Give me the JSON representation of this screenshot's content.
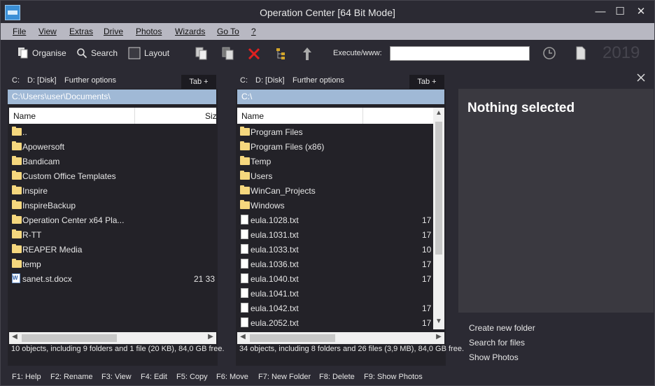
{
  "window": {
    "title": "Operation Center [64 Bit Mode]"
  },
  "window_controls": {
    "minimize": "—",
    "maximize": "☐",
    "close": "✕"
  },
  "menu": [
    "File",
    "View",
    "Extras",
    "Drive",
    "Photos",
    "Wizards",
    "Go To",
    "?"
  ],
  "toolbar": {
    "organise": "Organise",
    "search": "Search",
    "layout": "Layout",
    "execute_label": "Execute/www:",
    "execute_value": "",
    "year": "2019"
  },
  "left_panel": {
    "drives": [
      "C:",
      "D: [Disk]",
      "Further options"
    ],
    "tab_button": "Tab +",
    "path": "C:\\Users\\user\\Documents\\",
    "columns": [
      "Name",
      "Siz"
    ],
    "items": [
      {
        "name": "..",
        "size": "",
        "type": "folder"
      },
      {
        "name": "Apowersoft",
        "size": "",
        "type": "folder"
      },
      {
        "name": "Bandicam",
        "size": "",
        "type": "folder"
      },
      {
        "name": "Custom Office Templates",
        "size": "",
        "type": "folder"
      },
      {
        "name": "Inspire",
        "size": "",
        "type": "folder"
      },
      {
        "name": "InspireBackup",
        "size": "",
        "type": "folder"
      },
      {
        "name": "Operation Center x64 Pla...",
        "size": "",
        "type": "folder"
      },
      {
        "name": "R-TT",
        "size": "",
        "type": "folder"
      },
      {
        "name": "REAPER Media",
        "size": "",
        "type": "folder"
      },
      {
        "name": "temp",
        "size": "",
        "type": "folder"
      },
      {
        "name": "sanet.st.docx",
        "size": "21 33",
        "type": "docx"
      }
    ],
    "status": "10 objects, including 9 folders and 1 file (20 KB), 84,0 GB free."
  },
  "right_panel": {
    "drives": [
      "C:",
      "D: [Disk]",
      "Further options"
    ],
    "tab_button": "Tab +",
    "path": "C:\\",
    "columns": [
      "Name"
    ],
    "items": [
      {
        "name": "Program Files",
        "size": "",
        "type": "folder"
      },
      {
        "name": "Program Files (x86)",
        "size": "",
        "type": "folder"
      },
      {
        "name": "Temp",
        "size": "",
        "type": "folder"
      },
      {
        "name": "Users",
        "size": "",
        "type": "folder"
      },
      {
        "name": "WinCan_Projects",
        "size": "",
        "type": "folder"
      },
      {
        "name": "Windows",
        "size": "",
        "type": "folder"
      },
      {
        "name": "eula.1028.txt",
        "size": "17",
        "type": "file"
      },
      {
        "name": "eula.1031.txt",
        "size": "17",
        "type": "file"
      },
      {
        "name": "eula.1033.txt",
        "size": "10",
        "type": "file"
      },
      {
        "name": "eula.1036.txt",
        "size": "17",
        "type": "file"
      },
      {
        "name": "eula.1040.txt",
        "size": "17",
        "type": "file"
      },
      {
        "name": "eula.1041.txt",
        "size": "",
        "type": "file"
      },
      {
        "name": "eula.1042.txt",
        "size": "17",
        "type": "file"
      },
      {
        "name": "eula.2052.txt",
        "size": "17",
        "type": "file"
      }
    ],
    "status": "34 objects, including 8 folders and 26 files (3,9 MB), 84,0 GB free."
  },
  "info_pane": {
    "title": "Nothing selected",
    "links": [
      "Create new folder",
      "Search for files",
      "Show Photos"
    ]
  },
  "function_keys": [
    "F1: Help",
    "F2: Rename",
    "F3: View",
    "F4: Edit",
    "F5: Copy",
    "F6: Move",
    "F7: New Folder",
    "F8: Delete",
    "F9: Show Photos"
  ]
}
